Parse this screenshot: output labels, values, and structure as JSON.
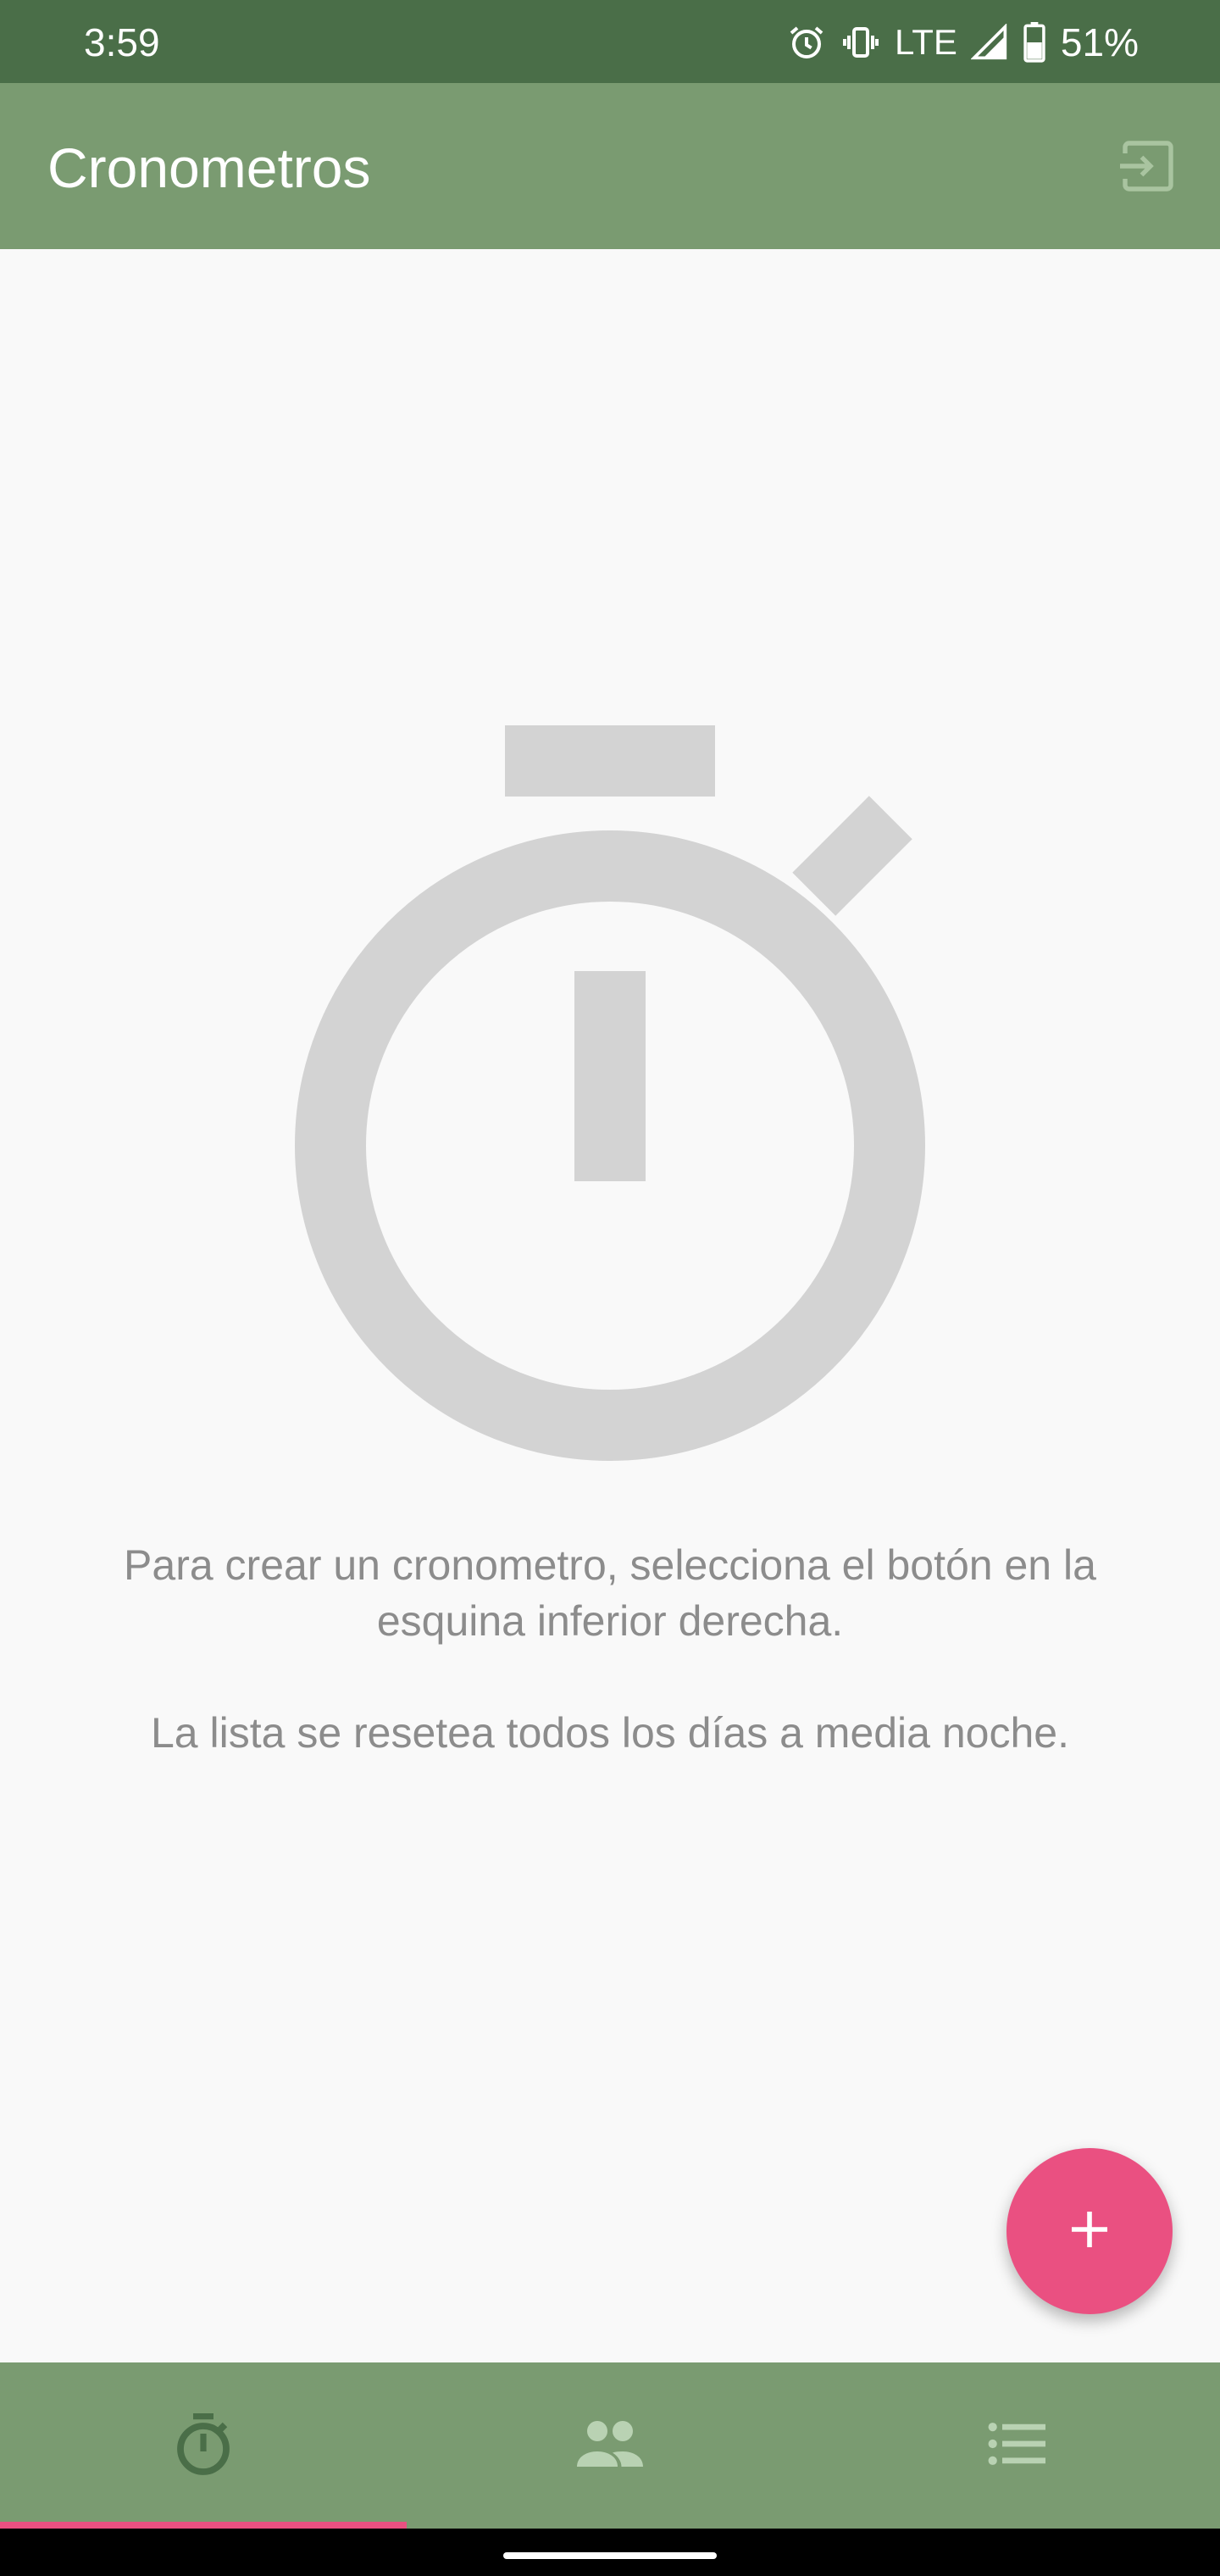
{
  "status_bar": {
    "time": "3:59",
    "network": "LTE",
    "battery": "51%",
    "icons": [
      "alarm-icon",
      "vibrate-icon",
      "signal-icon",
      "battery-icon"
    ]
  },
  "app_bar": {
    "title": "Cronometros",
    "action_icon": "logout-icon"
  },
  "empty_state": {
    "icon": "stopwatch-icon",
    "line1": "Para crear un cronometro, selecciona el botón en la esquina inferior derecha.",
    "line2": "La lista se resetea todos los días a media noche."
  },
  "fab": {
    "icon": "plus-icon"
  },
  "bottom_nav": {
    "selected_index": 0,
    "items": [
      {
        "icon": "timer-icon"
      },
      {
        "icon": "people-icon"
      },
      {
        "icon": "list-icon"
      }
    ]
  },
  "colors": {
    "status_bar": "#4a6e48",
    "app_bar": "#7a9b71",
    "accent": "#ea5081",
    "placeholder_gray": "#d3d3d3",
    "text_gray": "#8c8c8c",
    "nav_selected": "#4a6e48",
    "nav_unselected": "#b9d2b3"
  }
}
